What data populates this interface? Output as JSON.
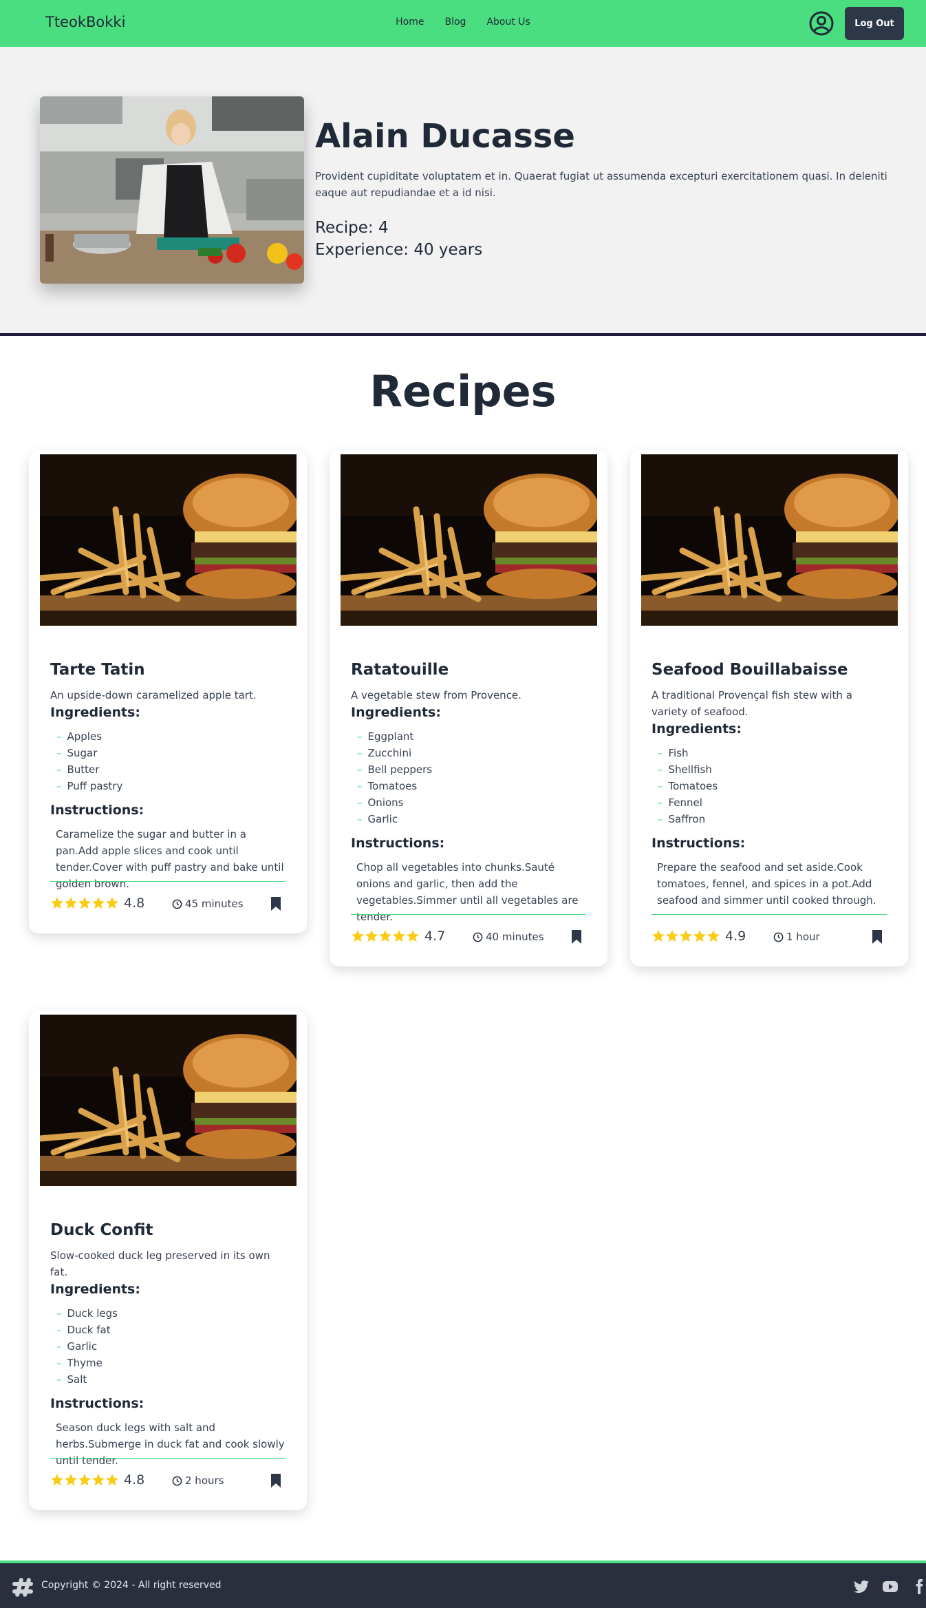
{
  "nav": {
    "brand": "TteokBokki",
    "links": [
      "Home",
      "Blog",
      "About Us"
    ],
    "logout_label": "Log Out"
  },
  "chef": {
    "name": "Alain Ducasse",
    "description": "Provident cupiditate voluptatem et in. Quaerat fugiat ut assumenda excepturi exercitationem quasi. In deleniti eaque aut repudiandae et a id nisi.",
    "recipe_label": "Recipe:",
    "recipe_count": "4",
    "experience_label": "Experience:",
    "experience_value": "40 years"
  },
  "recipes_heading": "Recipes",
  "section_labels": {
    "ingredients": "Ingredients:",
    "instructions": "Instructions:"
  },
  "recipes": [
    {
      "title": "Tarte Tatin",
      "description": "An upside-down caramelized apple tart.",
      "ingredients": [
        "Apples",
        "Sugar",
        "Butter",
        "Puff pastry"
      ],
      "instructions": "Caramelize the sugar and butter in a pan.Add apple slices and cook until tender.Cover with puff pastry and bake until golden brown.",
      "rating": "4.8",
      "time": "45 minutes"
    },
    {
      "title": "Ratatouille",
      "description": "A vegetable stew from Provence.",
      "ingredients": [
        "Eggplant",
        "Zucchini",
        "Bell peppers",
        "Tomatoes",
        "Onions",
        "Garlic"
      ],
      "instructions": "Chop all vegetables into chunks.Sauté onions and garlic, then add the vegetables.Simmer until all vegetables are tender.",
      "rating": "4.7",
      "time": "40 minutes"
    },
    {
      "title": "Seafood Bouillabaisse",
      "description": "A traditional Provençal fish stew with a variety of seafood.",
      "ingredients": [
        "Fish",
        "Shellfish",
        "Tomatoes",
        "Fennel",
        "Saffron"
      ],
      "instructions": "Prepare the seafood and set aside.Cook tomatoes, fennel, and spices in a pot.Add seafood and simmer until cooked through.",
      "rating": "4.9",
      "time": "1 hour"
    },
    {
      "title": "Duck Confit",
      "description": "Slow-cooked duck leg preserved in its own fat.",
      "ingredients": [
        "Duck legs",
        "Duck fat",
        "Garlic",
        "Thyme",
        "Salt"
      ],
      "instructions": "Season duck legs with salt and herbs.Submerge in duck fat and cook slowly until tender.",
      "rating": "4.8",
      "time": "2 hours"
    }
  ],
  "footer": {
    "copyright": "Copyright © 2024 - All right reserved",
    "social_icons": [
      "twitter-icon",
      "youtube-icon",
      "facebook-icon"
    ]
  },
  "colors": {
    "accent": "#4ade80",
    "dark": "#2d3748",
    "star": "#facc15",
    "hero_bg": "#f2f2f3"
  }
}
